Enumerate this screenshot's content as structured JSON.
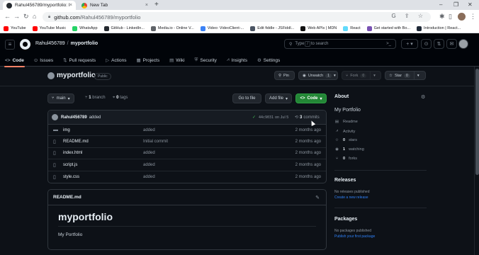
{
  "browser": {
    "tabs": [
      {
        "title": "Rahul456789/myportfolio: My Fi",
        "close": "×"
      },
      {
        "title": "New Tab",
        "close": "×"
      }
    ],
    "new_tab": "+",
    "window_controls": [
      "–",
      "❐",
      "✕"
    ],
    "nav": [
      "←",
      "→",
      "↻",
      "⌂"
    ],
    "url_host": "github.com",
    "url_path": "/Rahul456789/myportfolio",
    "omnibox_icons": "G ⇪ ☆",
    "extensions": [
      "✱",
      "▯",
      "⋮"
    ],
    "bookmarks": [
      {
        "label": "YouTube",
        "color": "#ff0000"
      },
      {
        "label": "YouTube Music",
        "color": "#ff0000"
      },
      {
        "label": "WhatsApp",
        "color": "#25d366"
      },
      {
        "label": "GitHub - LinkedIn...",
        "color": "#24292f"
      },
      {
        "label": "Media.io - Online V...",
        "color": "#5f6368"
      },
      {
        "label": "Video: VideoClient-...",
        "color": "#3b82f6"
      },
      {
        "label": "Edit fiddle - JSFiddl...",
        "color": "#4b5563"
      },
      {
        "label": "Web APIs | MDN",
        "color": "#111111"
      },
      {
        "label": "React",
        "color": "#61dafb"
      },
      {
        "label": "Get started with Bo...",
        "color": "#7952b3"
      },
      {
        "label": "Introduction | React...",
        "color": "#1f2937"
      }
    ]
  },
  "header": {
    "owner": "Rahul456789",
    "separator": "/",
    "repo": "myportfolio",
    "search_pre": "Type",
    "search_key": "/",
    "search_post": "to search",
    "command_icon": ">_",
    "buttons": [
      "+ ▾",
      "⊙",
      "⇅",
      "✉"
    ]
  },
  "repo_nav": [
    {
      "label": "Code",
      "icon": "<>"
    },
    {
      "label": "Issues",
      "icon": "⊙"
    },
    {
      "label": "Pull requests",
      "icon": "⇅"
    },
    {
      "label": "Actions",
      "icon": "▷"
    },
    {
      "label": "Projects",
      "icon": "▦"
    },
    {
      "label": "Wiki",
      "icon": "▤"
    },
    {
      "label": "Security",
      "icon": "⛨"
    },
    {
      "label": "Insights",
      "icon": "⩘"
    },
    {
      "label": "Settings",
      "icon": "⚙"
    }
  ],
  "repo_head": {
    "name": "myportfolio",
    "visibility": "Public",
    "pin": "Pin",
    "unwatch": "Unwatch",
    "unwatch_count": "1",
    "fork": "Fork",
    "fork_count": "0",
    "star": "Star",
    "star_count": "0",
    "dropdown": "▾"
  },
  "toolbar": {
    "branch": "main",
    "branch_count": "1",
    "branch_label": "branch",
    "tags_count": "0",
    "tags_label": "tags",
    "go_to_file": "Go to file",
    "add_file": "Add file",
    "code": "Code"
  },
  "commit": {
    "user": "Rahul456789",
    "message": "added",
    "check": "✓",
    "sha": "44c9031",
    "date": "on Jul 5",
    "count": "3",
    "count_label": "commits"
  },
  "files": [
    {
      "name": "img",
      "type": "dir",
      "message": "added",
      "date": "2 months ago"
    },
    {
      "name": "README.md",
      "type": "file",
      "message": "Initial commit",
      "date": "2 months ago"
    },
    {
      "name": "index.html",
      "type": "file",
      "message": "added",
      "date": "2 months ago"
    },
    {
      "name": "script.js",
      "type": "file",
      "message": "added",
      "date": "2 months ago"
    },
    {
      "name": "style.css",
      "type": "file",
      "message": "added",
      "date": "2 months ago"
    }
  ],
  "readme": {
    "filename": "README.md",
    "heading": "myportfolio",
    "body": "My Portfolio"
  },
  "sidebar": {
    "about_title": "About",
    "description": "My Portfolio",
    "items": [
      {
        "icon": "▤",
        "label": "Readme",
        "count": ""
      },
      {
        "icon": "⩘",
        "label": "Activity",
        "count": ""
      },
      {
        "icon": "☆",
        "label": "stars",
        "count": "0"
      },
      {
        "icon": "◉",
        "label": "watching",
        "count": "1"
      },
      {
        "icon": "⑂",
        "label": "forks",
        "count": "0"
      }
    ],
    "releases_title": "Releases",
    "releases_empty": "No releases published",
    "releases_link": "Create a new release",
    "packages_title": "Packages",
    "packages_empty": "No packages published",
    "packages_link": "Publish your first package"
  },
  "colors": {
    "accent_green": "#238636",
    "link_blue": "#2f81f7",
    "tab_underline": "#f78166",
    "background": "#0d1117"
  }
}
